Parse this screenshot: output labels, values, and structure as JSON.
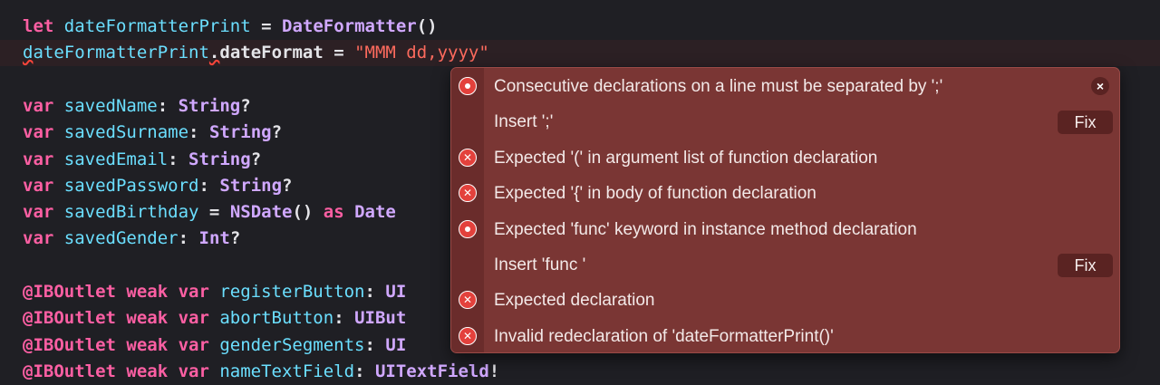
{
  "editor": {
    "lines": [
      [
        [
          "kw",
          "let "
        ],
        [
          "id",
          "dateFormatterPrint"
        ],
        [
          "pl",
          " = "
        ],
        [
          "ty",
          "DateFormatter"
        ],
        [
          "pl",
          "()"
        ]
      ],
      [
        [
          "id uerr",
          "d"
        ],
        [
          "id",
          "ateFormatterPrint"
        ],
        [
          "pl uerr",
          "."
        ],
        [
          "pl",
          "dateFormat = "
        ],
        [
          "str",
          "\"MMM dd,yyyy\""
        ]
      ],
      [],
      [
        [
          "kw",
          "var "
        ],
        [
          "id",
          "savedName"
        ],
        [
          "pl",
          ": "
        ],
        [
          "ty",
          "String"
        ],
        [
          "pl",
          "?"
        ]
      ],
      [
        [
          "kw",
          "var "
        ],
        [
          "id",
          "savedSurname"
        ],
        [
          "pl",
          ": "
        ],
        [
          "ty",
          "String"
        ],
        [
          "pl",
          "?"
        ]
      ],
      [
        [
          "kw",
          "var "
        ],
        [
          "id",
          "savedEmail"
        ],
        [
          "pl",
          ": "
        ],
        [
          "ty",
          "String"
        ],
        [
          "pl",
          "?"
        ]
      ],
      [
        [
          "kw",
          "var "
        ],
        [
          "id",
          "savedPassword"
        ],
        [
          "pl",
          ": "
        ],
        [
          "ty",
          "String"
        ],
        [
          "pl",
          "?"
        ]
      ],
      [
        [
          "kw",
          "var "
        ],
        [
          "id",
          "savedBirthday"
        ],
        [
          "pl",
          " = "
        ],
        [
          "ty",
          "NSDate"
        ],
        [
          "pl",
          "() "
        ],
        [
          "kw",
          "as "
        ],
        [
          "ty",
          "Date"
        ]
      ],
      [
        [
          "kw",
          "var "
        ],
        [
          "id",
          "savedGender"
        ],
        [
          "pl",
          ": "
        ],
        [
          "ty",
          "Int"
        ],
        [
          "pl",
          "?"
        ]
      ],
      [],
      [
        [
          "kw",
          "@IBOutlet weak var "
        ],
        [
          "id",
          "registerButton"
        ],
        [
          "pl",
          ": "
        ],
        [
          "ty",
          "UI"
        ]
      ],
      [
        [
          "kw",
          "@IBOutlet weak var "
        ],
        [
          "id",
          "abortButton"
        ],
        [
          "pl",
          ": "
        ],
        [
          "ty",
          "UIBut"
        ]
      ],
      [
        [
          "kw",
          "@IBOutlet weak var "
        ],
        [
          "id",
          "genderSegments"
        ],
        [
          "pl",
          ": "
        ],
        [
          "ty",
          "UI"
        ]
      ],
      [
        [
          "kw",
          "@IBOutlet weak var "
        ],
        [
          "id",
          "nameTextField"
        ],
        [
          "pl",
          ": "
        ],
        [
          "ty",
          "UITextField"
        ],
        [
          "pl",
          "!"
        ]
      ]
    ]
  },
  "issues": {
    "close_label": "×",
    "rows": [
      {
        "icon": "error-dot-icon",
        "text": "Consecutive declarations on a line must be separated by ';'",
        "action": "close"
      },
      {
        "icon": "",
        "text": "Insert ';'",
        "action": "fix",
        "fix_label": "Fix"
      },
      {
        "icon": "error-x-icon",
        "text": "Expected '(' in argument list of function declaration"
      },
      {
        "icon": "error-x-icon",
        "text": "Expected '{' in body of function declaration"
      },
      {
        "icon": "error-dot-icon",
        "text": "Expected 'func' keyword in instance method declaration"
      },
      {
        "icon": "",
        "text": "Insert 'func '",
        "action": "fix",
        "fix_label": "Fix"
      },
      {
        "icon": "error-x-icon",
        "text": "Expected declaration"
      },
      {
        "icon": "error-x-icon",
        "text": "Invalid redeclaration of 'dateFormatterPrint()'"
      }
    ]
  },
  "colors": {
    "background": "#1f1f24",
    "keyword": "#fc5fa3",
    "identifier": "#6bdfff",
    "type": "#d0a8ff",
    "string": "#fc6a5d",
    "error": "#e3413c",
    "popover": "#7a3634"
  }
}
